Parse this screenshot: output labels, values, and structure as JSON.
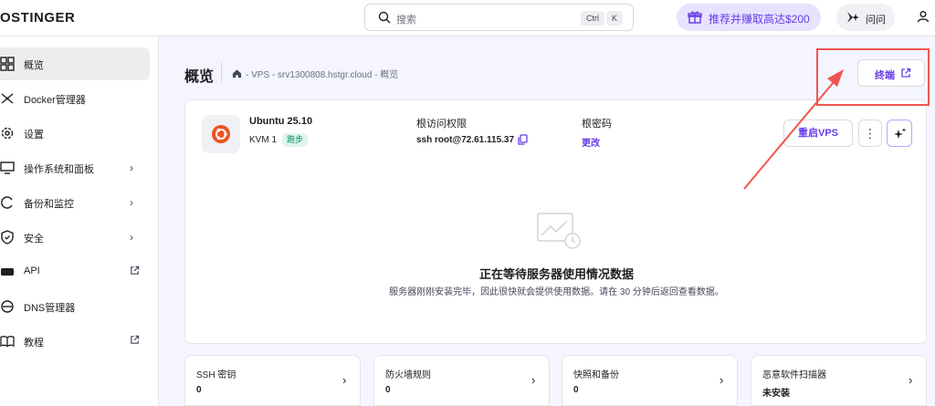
{
  "topbar": {
    "logo_text": "OSTINGER",
    "search_placeholder": "搜索",
    "shortcut_ctrl": "Ctrl",
    "shortcut_k": "K",
    "promo_label": "推荐并赚取高达$200",
    "ask_label": "问问"
  },
  "sidebar": {
    "items": [
      {
        "label": "概览",
        "icon": "dashboard-icon"
      },
      {
        "label": "Docker管理器",
        "icon": "docker-icon"
      },
      {
        "label": "设置",
        "icon": "gear-icon"
      },
      {
        "label": "操作系统和面板",
        "icon": "monitor-icon",
        "chevron": "›"
      },
      {
        "label": "备份和监控",
        "icon": "refresh-icon",
        "chevron": "›"
      },
      {
        "label": "安全",
        "icon": "shield-icon",
        "chevron": "›"
      },
      {
        "label": "API",
        "icon": "api-icon"
      },
      {
        "label": "DNS管理器",
        "icon": "dns-icon"
      },
      {
        "label": "教程",
        "icon": "book-icon"
      }
    ]
  },
  "header": {
    "title": "概览",
    "breadcrumb": "- VPS - srv1300808.hstgr.cloud - 概览",
    "terminal_label": "终端"
  },
  "server": {
    "os_name": "Ubuntu 25.10",
    "plan": "KVM 1",
    "status": "跑步",
    "access_label": "根访问权限",
    "access_value": "ssh root@72.61.115.37",
    "password_label": "根密码",
    "password_action": "更改",
    "restart_label": "重启VPS",
    "more_label": "⋮"
  },
  "empty_state": {
    "title": "正在等待服务器使用情况数据",
    "description": "服务器刚刚安装完毕，因此很快就会提供使用数据。请在 30 分钟后返回查看数据。"
  },
  "summary_cards": [
    {
      "label": "SSH 密钥",
      "value": "0"
    },
    {
      "label": "防火墙规则",
      "value": "0"
    },
    {
      "label": "快照和备份",
      "value": "0"
    },
    {
      "label": "恶意软件扫描器",
      "value": "未安装"
    }
  ],
  "colors": {
    "accent": "#673de6",
    "annotation": "#f0554f",
    "ubuntu": "#e95420"
  }
}
